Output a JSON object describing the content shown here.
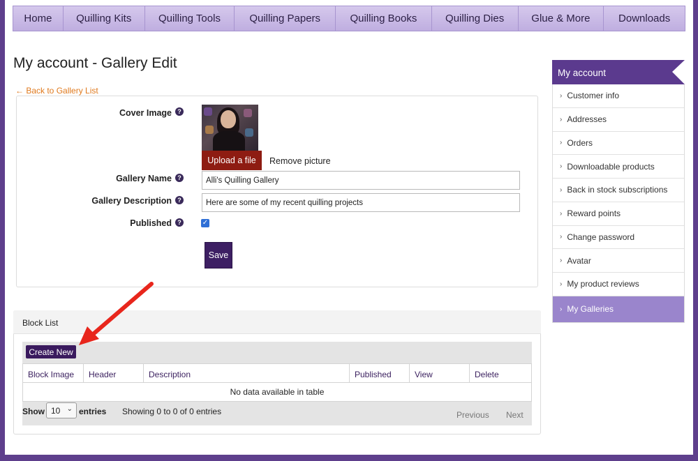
{
  "nav": {
    "items": [
      {
        "label": "Home",
        "w": 72
      },
      {
        "label": "Quilling Kits",
        "w": 117
      },
      {
        "label": "Quilling Tools",
        "w": 129
      },
      {
        "label": "Quilling Papers",
        "w": 145
      },
      {
        "label": "Quilling Books",
        "w": 138
      },
      {
        "label": "Quilling Dies",
        "w": 124
      },
      {
        "label": "Glue & More",
        "w": 123
      },
      {
        "label": "Downloads",
        "w": 116
      }
    ]
  },
  "page": {
    "title": "My account - Gallery Edit",
    "back_link": "← Back to Gallery List"
  },
  "form": {
    "cover_image_label": "Cover Image",
    "upload_label": "Upload a file",
    "remove_label": "Remove picture",
    "gallery_name_label": "Gallery Name",
    "gallery_name_value": "Alli's Quilling Gallery",
    "gallery_description_label": "Gallery Description",
    "gallery_description_value": "Here are some of my recent quilling projects",
    "published_label": "Published",
    "published_checked": true,
    "save_label": "Save",
    "help_glyph": "?"
  },
  "block_list": {
    "title": "Block List",
    "create_label": "Create New",
    "columns": [
      "Block Image",
      "Header",
      "Description",
      "Published",
      "View",
      "Delete"
    ],
    "empty_text": "No data available in table",
    "show_label": "Show",
    "page_size": "10",
    "entries_label": "entries",
    "showing_text": "Showing 0 to 0 of 0 entries",
    "previous_label": "Previous",
    "next_label": "Next"
  },
  "sidebar": {
    "title": "My account",
    "items": [
      {
        "label": "Customer info",
        "active": false
      },
      {
        "label": "Addresses",
        "active": false
      },
      {
        "label": "Orders",
        "active": false
      },
      {
        "label": "Downloadable products",
        "active": false
      },
      {
        "label": "Back in stock subscriptions",
        "active": false
      },
      {
        "label": "Reward points",
        "active": false
      },
      {
        "label": "Change password",
        "active": false
      },
      {
        "label": "Avatar",
        "active": false
      },
      {
        "label": "My product reviews",
        "active": false
      },
      {
        "label": "My Galleries",
        "active": true
      }
    ]
  },
  "colors": {
    "brand_purple": "#5b3a8e",
    "upload_red": "#8e1c12",
    "link_orange": "#e07a1e",
    "arrow_red": "#e8261c"
  }
}
